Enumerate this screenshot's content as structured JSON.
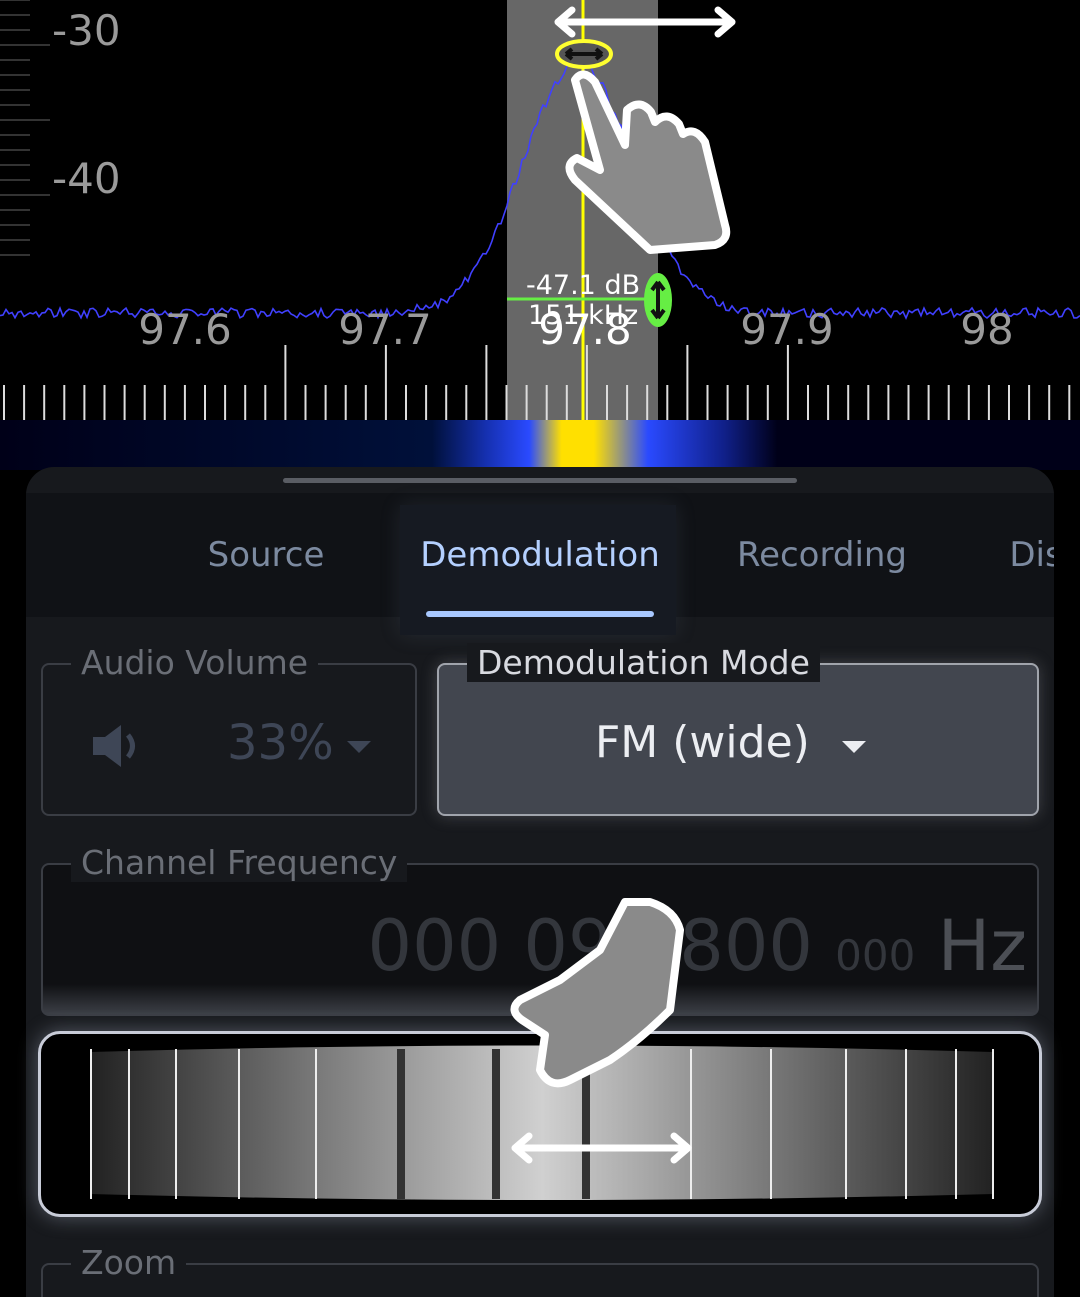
{
  "spectrum": {
    "y_labels": [
      "-30",
      "-40"
    ],
    "x_labels": [
      "97.6",
      "97.7",
      "97.8",
      "97.9",
      "98"
    ],
    "marker_level": "-47.1 dB",
    "bandwidth": "151 kHz",
    "colors": {
      "trace": "#3a3aff",
      "center": "#ffff00",
      "squelch": "#66ee44"
    }
  },
  "tabs": [
    {
      "label": "Source"
    },
    {
      "label": "Demodulation",
      "active": true
    },
    {
      "label": "Recording"
    },
    {
      "label": "Dis"
    }
  ],
  "audio": {
    "label": "Audio Volume",
    "value": "33%"
  },
  "mode": {
    "label": "Demodulation Mode",
    "value": "FM (wide)"
  },
  "channel": {
    "label": "Channel Frequency",
    "ghz": "000",
    "mhz": "097",
    "khz": "800",
    "hz": "000",
    "unit": "Hz"
  },
  "zoom": {
    "label": "Zoom"
  }
}
